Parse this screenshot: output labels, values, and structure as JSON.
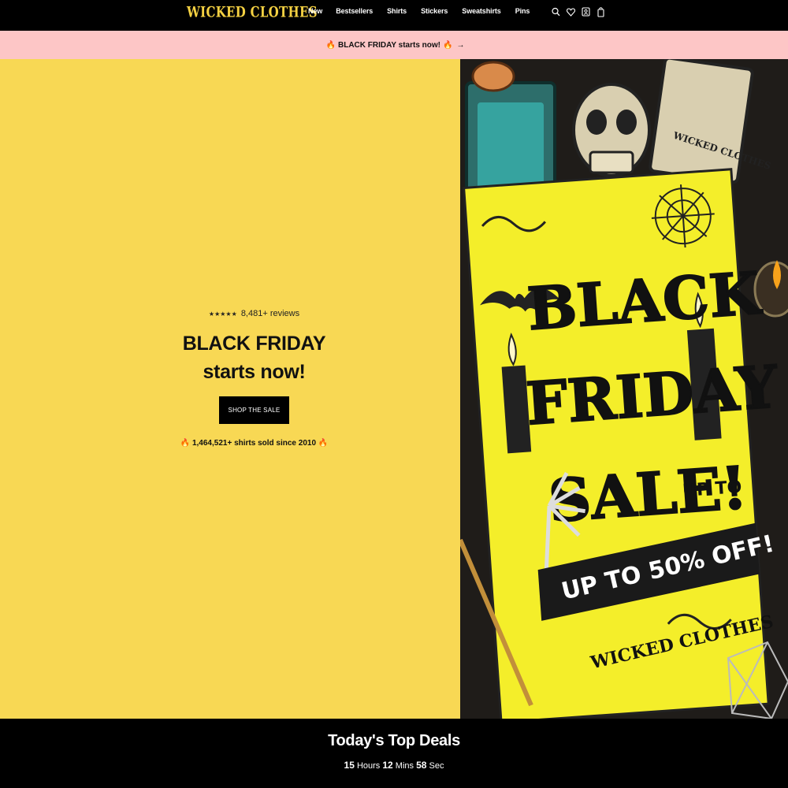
{
  "header": {
    "logo": "WICKED CLOTHES",
    "nav": [
      "New",
      "Bestsellers",
      "Shirts",
      "Stickers",
      "Sweatshirts",
      "Pins"
    ],
    "icons": [
      "search-icon",
      "heart-icon",
      "account-icon",
      "cart-icon"
    ]
  },
  "announcement": {
    "emoji_left": "🔥",
    "text": "BLACK FRIDAY starts now!",
    "emoji_right": "🔥",
    "arrow": "→"
  },
  "hero": {
    "stars": "★★★★★",
    "reviews": "8,481+ reviews",
    "headline_line1": "BLACK FRIDAY",
    "headline_line2": "starts now!",
    "cta": "SHOP THE SALE",
    "sold_emoji": "🔥",
    "sold": "1,464,521+ shirts sold since 2010",
    "image": {
      "line1": "BLACK",
      "line2": "FRIDAY",
      "line3": "SALE!",
      "badge": "UP TO",
      "banner": "UP TO 50% OFF!",
      "brand": "WICKED CLOTHES",
      "card_text": "WICKED CLOTHES"
    }
  },
  "deals": {
    "title": "Today's Top Deals",
    "hours": "15",
    "hours_label": "Hours",
    "mins": "12",
    "mins_label": "Mins",
    "secs": "58",
    "secs_label": "Sec"
  },
  "colors": {
    "brand_yellow": "#f8d854",
    "logo_yellow": "#f5d142",
    "announcement_pink": "#fdc6c6",
    "black": "#000000"
  }
}
